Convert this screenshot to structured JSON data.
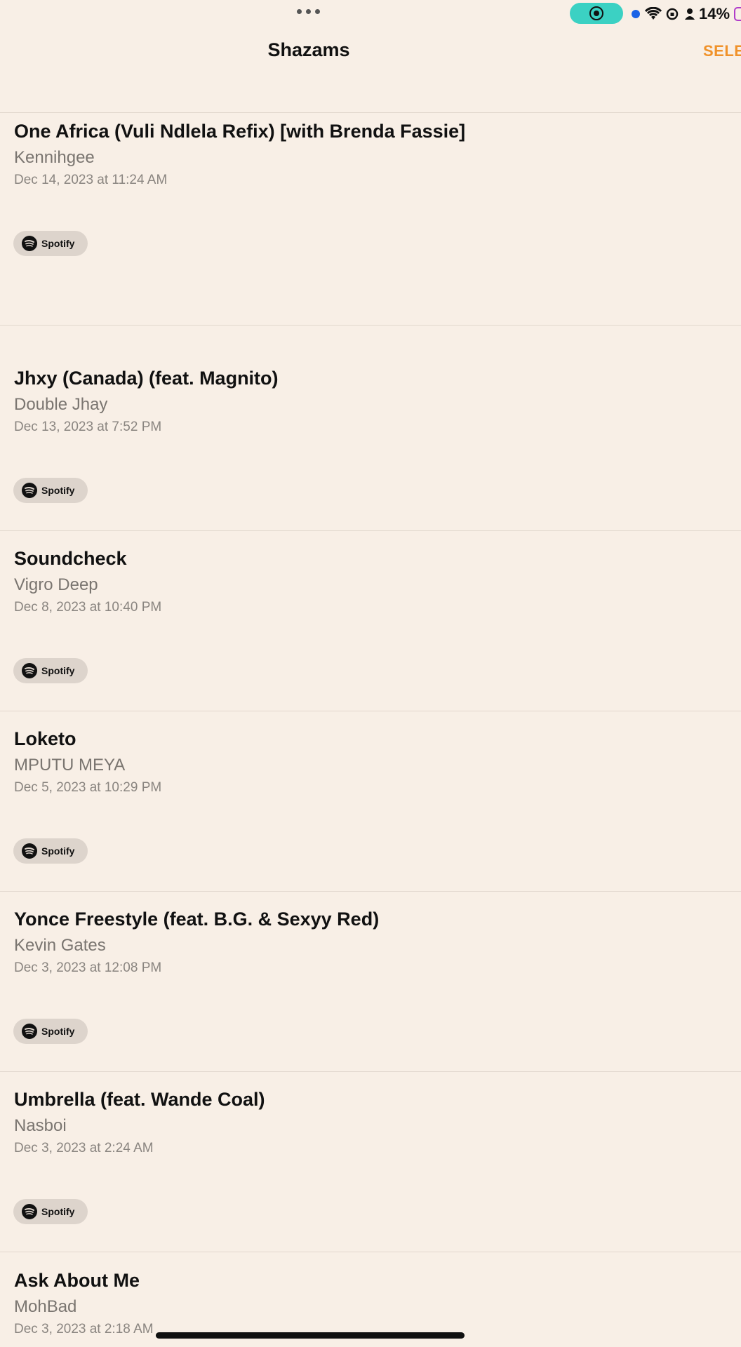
{
  "status_bar": {
    "battery_text": "14%",
    "accent_color": "#3bd1c3",
    "battery_color": "#b03cc9"
  },
  "nav": {
    "title": "Shazams",
    "select_label": "SELE"
  },
  "colors": {
    "background": "#f8efe6",
    "accent": "#f0922a",
    "chip": "#ddd4cc"
  },
  "items": [
    {
      "title": "One Africa (Vuli Ndlela Refix) [with Brenda Fassie]",
      "artist": "Kennihgee",
      "date": "Dec 14, 2023 at 11:24 AM",
      "service": "Spotify"
    },
    {
      "title": "Jhxy (Canada) (feat. Magnito)",
      "artist": "Double Jhay",
      "date": "Dec 13, 2023 at 7:52 PM",
      "service": "Spotify"
    },
    {
      "title": "Soundcheck",
      "artist": "Vigro Deep",
      "date": "Dec 8, 2023 at 10:40 PM",
      "service": "Spotify"
    },
    {
      "title": "Loketo",
      "artist": "MPUTU MEYA",
      "date": "Dec 5, 2023 at 10:29 PM",
      "service": "Spotify"
    },
    {
      "title": "Yonce Freestyle (feat. B.G. & Sexyy Red)",
      "artist": "Kevin Gates",
      "date": "Dec 3, 2023 at 12:08 PM",
      "service": "Spotify"
    },
    {
      "title": "Umbrella (feat. Wande Coal)",
      "artist": "Nasboi",
      "date": "Dec 3, 2023 at 2:24 AM",
      "service": "Spotify"
    },
    {
      "title": "Ask About Me",
      "artist": "MohBad",
      "date": "Dec 3, 2023 at 2:18 AM",
      "service": ""
    }
  ]
}
